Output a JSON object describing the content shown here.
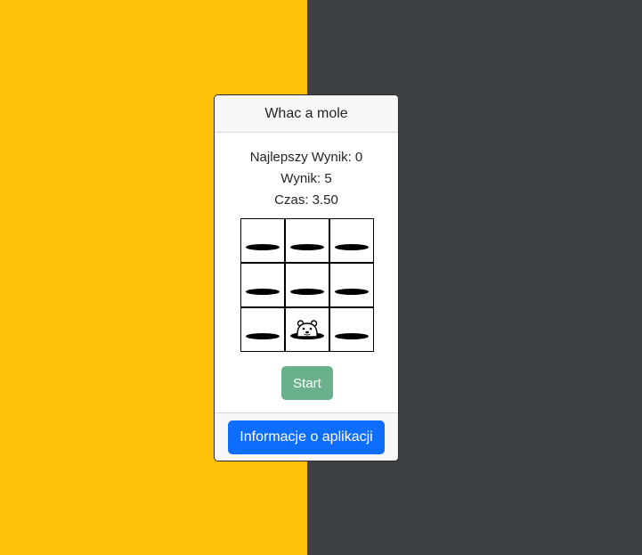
{
  "colors": {
    "left_bg": "#ffc107",
    "right_bg": "#3d4146",
    "start_button": "#69b08d",
    "info_button": "#0d6efd"
  },
  "game": {
    "title": "Whac a mole",
    "best_score_label": "Najlepszy Wynik: 0",
    "score_label": "Wynik: 5",
    "time_label": "Czas: 3.50",
    "board": {
      "rows": 3,
      "cols": 3,
      "mole_cell": 7
    },
    "start_label": "Start"
  },
  "footer": {
    "info_label": "Informacje o aplikacji"
  }
}
